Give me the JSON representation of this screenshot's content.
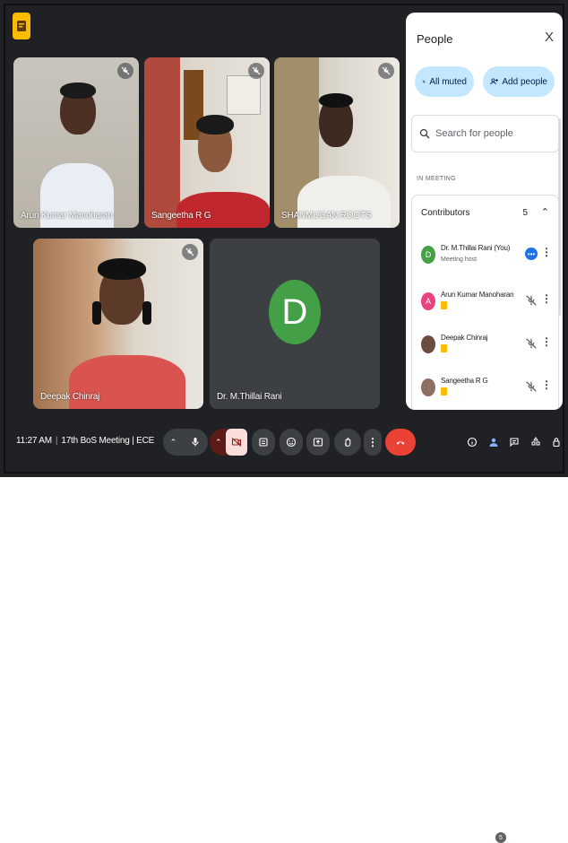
{
  "colors": {
    "background": "#202124",
    "panel": "#ffffff",
    "accent_blue": "#1a73e8",
    "end_call": "#ea4335",
    "chip": "#c2e7ff"
  },
  "tiles": [
    {
      "name": "Arun Kumar Manoharan",
      "muted": true
    },
    {
      "name": "Sangeetha R G",
      "muted": true
    },
    {
      "name": "SHANMUGAN ROOTS",
      "muted": true
    },
    {
      "name": "Deepak Chinraj",
      "muted": true
    },
    {
      "name": "Dr. M.Thillai Rani",
      "avatar_letter": "D",
      "avatar_color": "#43a047"
    }
  ],
  "people_panel": {
    "title": "People",
    "close_label": "X",
    "all_muted_label": "All muted",
    "add_people_label": "Add people",
    "search_placeholder": "Search for people",
    "section_label": "IN MEETING",
    "contributors_label": "Contributors",
    "contributors_count": "5",
    "people": [
      {
        "name": "Dr. M.Thillai Rani (You)",
        "subtitle": "Meeting host",
        "avatar_letter": "D",
        "avatar_color": "#43a047"
      },
      {
        "name": "Arun Kumar Manoharan",
        "avatar_letter": "A",
        "avatar_color": "#e8437e"
      },
      {
        "name": "Deepak Chinraj",
        "avatar_letter": "",
        "avatar_color": "#6d4c41"
      },
      {
        "name": "Sangeetha R G",
        "avatar_letter": "",
        "avatar_color": "#8d6e63"
      }
    ]
  },
  "bottom_bar": {
    "time": "11:27 AM",
    "meeting_name": "17th BoS Meeting | ECE",
    "people_badge": "5"
  }
}
